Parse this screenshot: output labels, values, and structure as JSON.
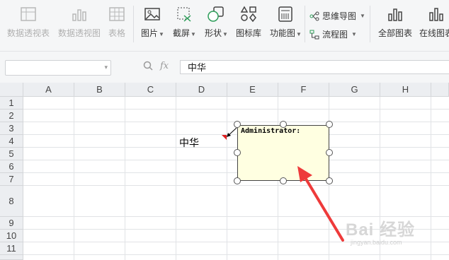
{
  "ribbon": {
    "items": [
      {
        "label": "数据透视表",
        "icon": "pivot-table-icon",
        "enabled": false
      },
      {
        "label": "数据透视图",
        "icon": "pivot-chart-icon",
        "enabled": false
      },
      {
        "label": "表格",
        "icon": "table-icon",
        "enabled": false
      },
      {
        "label": "图片",
        "icon": "picture-icon",
        "enabled": true
      },
      {
        "label": "截屏",
        "icon": "screenshot-icon",
        "enabled": true
      },
      {
        "label": "形状",
        "icon": "shapes-icon",
        "enabled": true
      },
      {
        "label": "图标库",
        "icon": "icon-library-icon",
        "enabled": true
      },
      {
        "label": "功能图",
        "icon": "function-chart-icon",
        "enabled": true
      },
      {
        "label": "思维导图",
        "icon": "mind-map-icon",
        "enabled": true
      },
      {
        "label": "流程图",
        "icon": "flowchart-icon",
        "enabled": true
      },
      {
        "label": "全部图表",
        "icon": "all-charts-icon",
        "enabled": true
      },
      {
        "label": "在线图表",
        "icon": "online-chart-icon",
        "enabled": true
      }
    ]
  },
  "formula_bar": {
    "name_box": "",
    "fx": "fx",
    "content": "中华"
  },
  "sheet": {
    "columns": [
      "A",
      "B",
      "C",
      "D",
      "E",
      "F",
      "G",
      "H"
    ],
    "rows": [
      "1",
      "2",
      "3",
      "4",
      "5",
      "6",
      "7",
      "8",
      "9",
      "10",
      "11"
    ],
    "cell_d4": "中华"
  },
  "comment": {
    "author": "Administrator:"
  },
  "colors": {
    "comment_bg": "#ffffe1",
    "annotation_arrow": "#ee3a3a",
    "comment_marker": "#e02020"
  },
  "watermark": {
    "text": "Bai 经验",
    "sub": "jingyan.baidu.com"
  }
}
